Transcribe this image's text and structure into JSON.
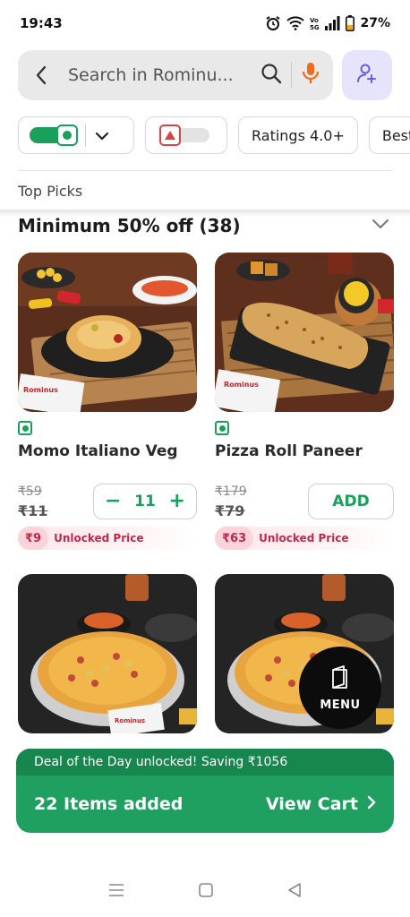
{
  "status": {
    "time": "19:43",
    "battery": "27%"
  },
  "search": {
    "placeholder": "Search in Rominu..."
  },
  "filters": {
    "ratings": "Ratings 4.0+",
    "bestseller": "Bestse"
  },
  "top_picks": "Top Picks",
  "section": {
    "title": "Minimum 50% off (38)"
  },
  "products": [
    {
      "name": "Momo Italiano Veg",
      "price_old": "₹59",
      "price_new": "₹11",
      "quantity": "11",
      "unlock_price": "₹9",
      "unlock_label": "Unlocked Price"
    },
    {
      "name": "Pizza Roll Paneer",
      "price_old": "₹179",
      "price_new": "₹79",
      "add_label": "ADD",
      "unlock_price": "₹63",
      "unlock_label": "Unlocked Price"
    }
  ],
  "menu": {
    "label": "MENU"
  },
  "cart": {
    "deal_text": "Deal of the Day unlocked! Saving ₹1056",
    "items_added": "22 Items added",
    "view_cart": "View Cart"
  },
  "colors": {
    "brand_green": "#1fa060",
    "veg_green": "#1aa05a",
    "unlock_red": "#c3284a",
    "mic_orange": "#f06a1d"
  },
  "icons": [
    "back-arrow-icon",
    "search-icon",
    "mic-icon",
    "add-profile-icon",
    "chevron-down-icon",
    "menu-book-icon",
    "chevron-right-icon"
  ]
}
